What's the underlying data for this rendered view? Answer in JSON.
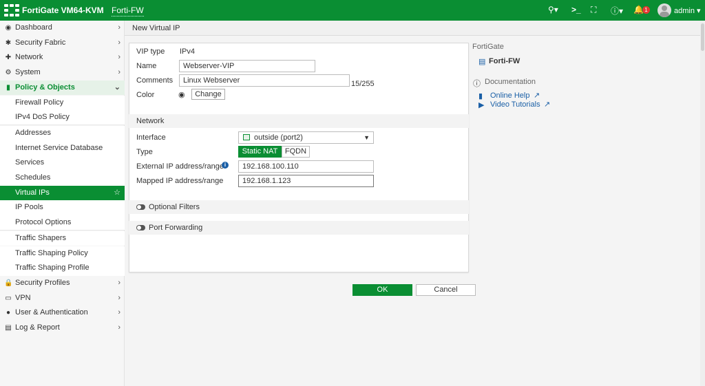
{
  "topbar": {
    "product": "FortiGate VM64-KVM",
    "hostname": "Forti-FW",
    "search_icon": "search-icon",
    "cli_icon": "terminal-icon",
    "fullscreen_icon": "fullscreen-icon",
    "help_icon": "help-icon",
    "notifications_icon": "bell-icon",
    "notification_count": "1",
    "user": "admin",
    "accent": "#0a8e33"
  },
  "sidebar": {
    "items": [
      {
        "label": "Dashboard",
        "icon": "dashboard-icon",
        "chev": "›"
      },
      {
        "label": "Security Fabric",
        "icon": "fabric-icon",
        "chev": "›"
      },
      {
        "label": "Network",
        "icon": "network-icon",
        "chev": "›"
      },
      {
        "label": "System",
        "icon": "gear-icon",
        "chev": "›"
      },
      {
        "label": "Policy & Objects",
        "icon": "policy-icon",
        "chev": "⌄"
      },
      {
        "label": "Firewall Policy"
      },
      {
        "label": "IPv4 DoS Policy"
      },
      {
        "label": "Addresses"
      },
      {
        "label": "Internet Service Database"
      },
      {
        "label": "Services"
      },
      {
        "label": "Schedules"
      },
      {
        "label": "Virtual IPs",
        "chev": "☆"
      },
      {
        "label": "IP Pools"
      },
      {
        "label": "Protocol Options"
      },
      {
        "label": "Traffic Shapers"
      },
      {
        "label": "Traffic Shaping Policy"
      },
      {
        "label": "Traffic Shaping Profile"
      },
      {
        "label": "Security Profiles",
        "icon": "lock-icon",
        "chev": "›"
      },
      {
        "label": "VPN",
        "icon": "vpn-icon",
        "chev": "›"
      },
      {
        "label": "User & Authentication",
        "icon": "user-icon",
        "chev": "›"
      },
      {
        "label": "Log & Report",
        "icon": "chart-icon",
        "chev": "›"
      }
    ]
  },
  "breadcrumb": "New Virtual IP",
  "form": {
    "vip_type_label": "VIP type",
    "vip_type_value": "IPv4",
    "name_label": "Name",
    "name_value": "Webserver-VIP",
    "comments_label": "Comments",
    "comments_value": "Linux Webserver",
    "comments_count": "15/255",
    "color_label": "Color",
    "change_button": "Change",
    "network_section": "Network",
    "interface_label": "Interface",
    "interface_value": "outside (port2)",
    "type_label": "Type",
    "type_static_nat": "Static NAT",
    "type_fqdn": "FQDN",
    "external_ip_label": "External IP address/range",
    "external_ip_value": "192.168.100.110",
    "mapped_ip_label": "Mapped IP address/range",
    "mapped_ip_value": "192.168.1.123",
    "optional_filters": "Optional Filters",
    "port_forwarding": "Port Forwarding"
  },
  "buttons": {
    "ok": "OK",
    "cancel": "Cancel"
  },
  "right_panel": {
    "device_heading": "FortiGate",
    "device_name": "Forti-FW",
    "documentation_heading": "Documentation",
    "online_help": "Online Help",
    "video_tutorials": "Video Tutorials"
  }
}
